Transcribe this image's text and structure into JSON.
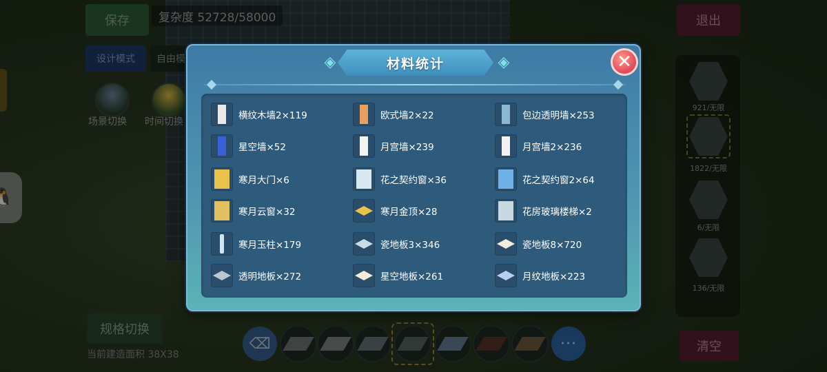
{
  "background": {
    "save_label": "保存",
    "complexity_text": "复杂度 52728/58000",
    "design_mode_label": "设计模式",
    "free_label": "自由模",
    "scene_switch_label": "场景切换",
    "time_switch_label": "时间切换",
    "exit_label": "退出",
    "spec_switch_label": "规格切换",
    "build_area_label": "当前建造面积 38X38",
    "clear_label": "清空",
    "side_counts": [
      "921/无限",
      "1822/无限",
      "6/无限",
      "136/无限"
    ]
  },
  "dialog": {
    "title": "材料统计",
    "close_glyph": "✕",
    "items": [
      {
        "label": "横纹木墙2×119",
        "icon": "striped-wood-wall-icon",
        "color": "#e8e8e8"
      },
      {
        "label": "欧式墙2×22",
        "icon": "european-wall-icon",
        "color": "#e8a060"
      },
      {
        "label": "包边透明墙×253",
        "icon": "edged-transparent-wall-icon",
        "color": "#8ab8d0"
      },
      {
        "label": "星空墙×52",
        "icon": "starry-wall-icon",
        "color": "#3a5fd8"
      },
      {
        "label": "月宫墙×239",
        "icon": "moon-palace-wall-icon",
        "color": "#f2f2f2"
      },
      {
        "label": "月宫墙2×236",
        "icon": "moon-palace-wall-2-icon",
        "color": "#f2f2f2"
      },
      {
        "label": "寒月大门×6",
        "icon": "cold-moon-gate-icon",
        "color": "#e8c24a"
      },
      {
        "label": "花之契约窗×36",
        "icon": "flower-contract-window-icon",
        "color": "#d8e8f0"
      },
      {
        "label": "花之契约窗2×64",
        "icon": "flower-contract-window-2-icon",
        "color": "#6fb0e8"
      },
      {
        "label": "寒月云窗×32",
        "icon": "cold-moon-cloud-window-icon",
        "color": "#e0c060"
      },
      {
        "label": "寒月金顶×28",
        "icon": "cold-moon-golden-roof-icon",
        "color": "#e8c24a"
      },
      {
        "label": "花房玻璃楼梯×2",
        "icon": "greenhouse-glass-stairs-icon",
        "color": "#c8d8e0"
      },
      {
        "label": "寒月玉柱×179",
        "icon": "cold-moon-jade-pillar-icon",
        "color": "#d0e4f2"
      },
      {
        "label": "瓷地板3×346",
        "icon": "porcelain-floor-3-icon",
        "color": "#c8dce8"
      },
      {
        "label": "瓷地板8×720",
        "icon": "porcelain-floor-8-icon",
        "color": "#f4ecdc"
      },
      {
        "label": "透明地板×272",
        "icon": "transparent-floor-icon",
        "color": "#b8c8d0"
      },
      {
        "label": "星空地板×261",
        "icon": "starry-floor-icon",
        "color": "#f4ecd8"
      },
      {
        "label": "月纹地板×223",
        "icon": "moon-pattern-floor-icon",
        "color": "#b8d0ec"
      }
    ]
  },
  "hotbar": {
    "more_glyph": "···"
  }
}
